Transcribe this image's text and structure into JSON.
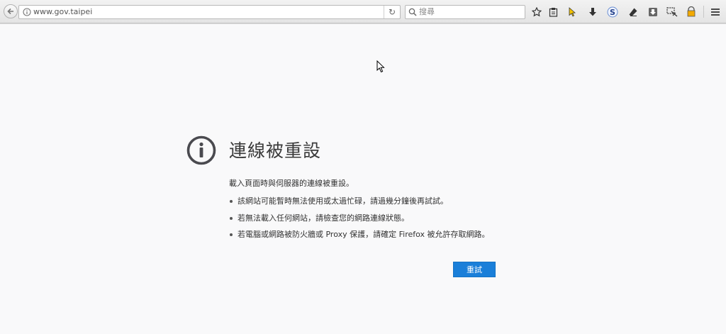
{
  "browser": {
    "url": "www.gov.taipei",
    "search_placeholder": "搜尋"
  },
  "error": {
    "title": "連線被重設",
    "description": "載入頁面時與伺服器的連線被重設。",
    "bullets": [
      "該網站可能暫時無法使用或太過忙碌，請過幾分鐘後再試試。",
      "若無法載入任何網站，請檢查您的網路連線狀態。",
      "若電腦或網路被防火牆或 Proxy 保護，請確定 Firefox 被允許存取網路。"
    ],
    "retry_label": "重試"
  },
  "colors": {
    "accent": "#1a7fd9",
    "page_bg": "#f9f9fa",
    "title": "#3b3b3b"
  }
}
